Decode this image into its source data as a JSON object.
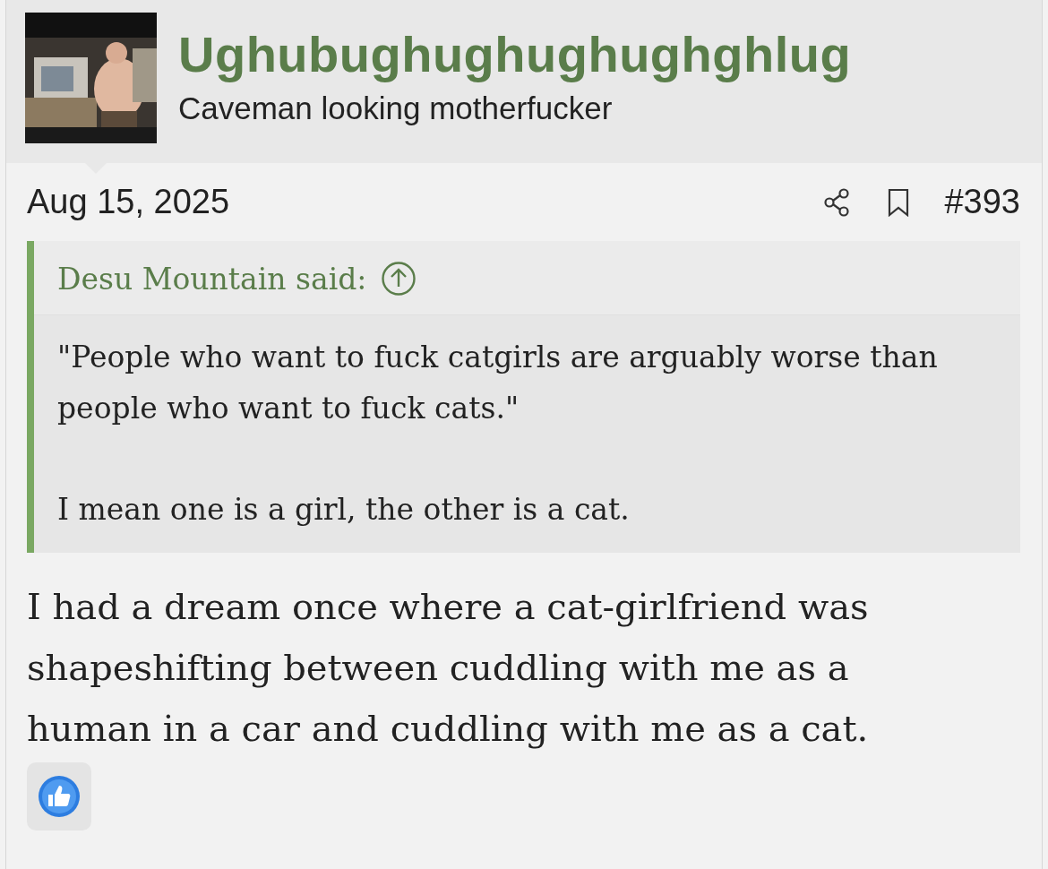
{
  "user": {
    "name": "Ughubughughughughghlug",
    "title": "Caveman looking motherfucker"
  },
  "post": {
    "date": "Aug 15, 2025",
    "number": "#393",
    "quote": {
      "attribution": "Desu Mountain said:",
      "paragraphs": [
        "\"People who want to fuck catgirls are arguably worse than people who want to fuck cats.\"",
        "I mean one is a girl, the other is a cat."
      ]
    },
    "body": "I had a dream once where a cat-girlfriend was shapeshifting between cuddling with me as a human in a car and cuddling with me as a cat.",
    "reactions": [
      {
        "kind": "like"
      }
    ]
  }
}
